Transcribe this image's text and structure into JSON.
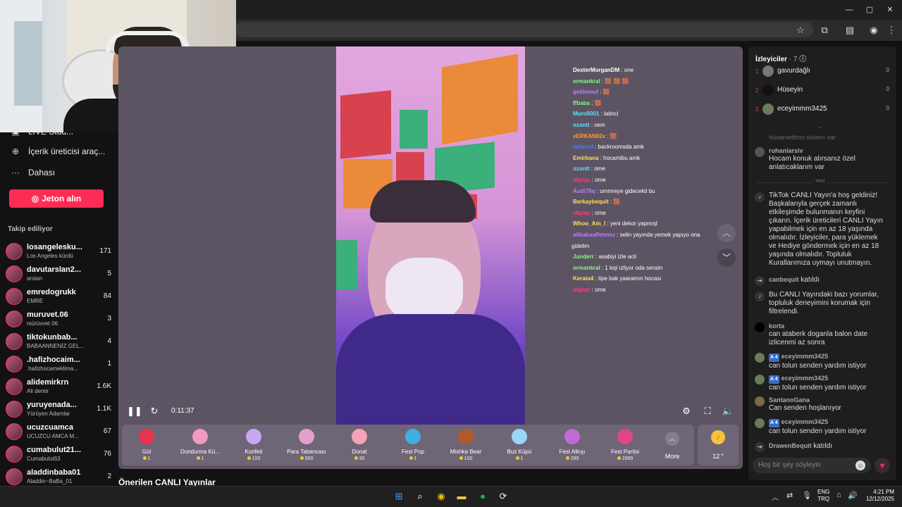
{
  "sidebar": {
    "live_center": "LIVE Stüd...",
    "creator_tools": "İçerik üreticisi araç...",
    "more": "Dahası",
    "get_coins": "Jeton alın",
    "following_header": "Takip ediliyor",
    "following": [
      {
        "name": "losangelesku...",
        "sub": "Los Angeles kürdü",
        "count": "171"
      },
      {
        "name": "davutarslan2...",
        "sub": "arslan",
        "count": "5"
      },
      {
        "name": "emredogrukk",
        "sub": "EMRE",
        "count": "84"
      },
      {
        "name": "muruvet.06",
        "sub": "mürüvvet 06",
        "count": "3"
      },
      {
        "name": "tiktokunbab...",
        "sub": "BABAANNENİZ GEL...",
        "count": "4"
      },
      {
        "name": ".hafizhocaim...",
        "sub": ".hafizhocameklima...",
        "count": "1"
      },
      {
        "name": "alidemirkrn",
        "sub": "Ali demir",
        "count": "1.6K"
      },
      {
        "name": "yuruyenada...",
        "sub": "Yürüyen Adamlar",
        "count": "1.1K"
      },
      {
        "name": "ucuzcuamca",
        "sub": "UCUZCU AMCA M...",
        "count": "67"
      },
      {
        "name": "cumabulut21...",
        "sub": "Cumabulut63",
        "count": "76"
      },
      {
        "name": "aladdinbaba01",
        "sub": "Aladdin~BaBa_01",
        "count": "2"
      }
    ]
  },
  "suggested_title": "Önerilen CANLI Yayınlar",
  "player": {
    "time": "0:11:37",
    "chat": [
      {
        "user": "DexterMorganDM",
        "text": " : one",
        "color": "#ffffff"
      },
      {
        "user": "ormankral",
        "text": " : 🟫 🟫 🟫",
        "color": "#7fff7f"
      },
      {
        "user": "geblomuf",
        "text": " : 🟫",
        "color": "#b77fff"
      },
      {
        "user": "ffbaba",
        "text": " : 🟫",
        "color": "#7fff7f"
      },
      {
        "user": "Muro8001",
        "text": " : latinci",
        "color": "#5fdfff"
      },
      {
        "user": "ozantt",
        "text": " : oem",
        "color": "#5fdfff"
      },
      {
        "user": "xERKAN02x",
        "text": " : 🟫",
        "color": "#ff9f3f"
      },
      {
        "user": "fafamuf",
        "text": " : backroomsda amk",
        "color": "#3f7fff"
      },
      {
        "user": "Emirbana",
        "text": " : hocamibu amk",
        "color": "#ffdf5f"
      },
      {
        "user": "ozantt",
        "text": " : ome",
        "color": "#5fdfff"
      },
      {
        "user": "slqzqz",
        "text": " : ome",
        "color": "#ff3f7f"
      },
      {
        "user": "Audi78q",
        "text": " : ummreye gidecekti bu",
        "color": "#b77fff"
      },
      {
        "user": "Berkaybequit",
        "text": " : 🟫",
        "color": "#ffdf5f"
      },
      {
        "user": "slqzqz",
        "text": " : ome",
        "color": "#ff3f7f"
      },
      {
        "user": "Whoo_Am_I",
        "text": " : yeni dekor yapmışl",
        "color": "#ffdf5f"
      },
      {
        "user": "alibabaaffetmez",
        "text": " : selin yayında yemek yapıyo ona",
        "color": "#b77fff"
      },
      {
        "user": "",
        "text": "gidelim",
        "color": "#ffffff"
      },
      {
        "user": "Junderr",
        "text": " : asabiyi izle acil",
        "color": "#7fff7f"
      },
      {
        "user": "ormankral",
        "text": " : 1 kişi izliyor oda sensin",
        "color": "#7fff7f"
      },
      {
        "user": "Kerata4",
        "text": " : tipe bak yaaramın hocası",
        "color": "#ffdf5f"
      },
      {
        "user": "slqzqz",
        "text": " : ome",
        "color": "#ff3f7f"
      }
    ]
  },
  "gifts": [
    {
      "name": "Gül",
      "price": "1",
      "color": "#e8334f"
    },
    {
      "name": "Dondurma Kü...",
      "price": "1",
      "color": "#f29ac0"
    },
    {
      "name": "Konfeti",
      "price": "100",
      "color": "#c9a8f2"
    },
    {
      "name": "Para Tabancası",
      "price": "500",
      "color": "#e6a0d0"
    },
    {
      "name": "Donat",
      "price": "30",
      "color": "#f5a3b8"
    },
    {
      "name": "Fest Pop",
      "price": "1",
      "color": "#3fb0e0"
    },
    {
      "name": "Mishka Bear",
      "price": "100",
      "color": "#b05a2a"
    },
    {
      "name": "Buz Küpü",
      "price": "1",
      "color": "#9ad6f5"
    },
    {
      "name": "Fest Alkışı",
      "price": "299",
      "color": "#c06ad8"
    },
    {
      "name": "Fest Partisi",
      "price": "2999",
      "color": "#e0458a"
    }
  ],
  "gift_more": "More",
  "coin_count": "12",
  "right": {
    "viewers_title": "İzleyiciler",
    "viewers_count": "· 7",
    "viewers": [
      {
        "rank": "1",
        "name": "gavurdağlı",
        "score": "0"
      },
      {
        "rank": "2",
        "name": "Hüseyin",
        "score": "0"
      },
      {
        "rank": "3",
        "name": "eceyimmm3425",
        "score": "0"
      }
    ],
    "faded_msg": "hüsamettinin selamı var",
    "comments": [
      {
        "user": "ruhaniarsiv",
        "text": "Hocam konuk alırsanız özel anlatıcaklarım var"
      }
    ],
    "new_label": "Yeni",
    "welcome": "TikTok CANLI Yayın'a hoş geldiniz! Başkalarıyla gerçek zamanlı etkileşimde bulunmanın keyfini çıkarın. İçerik üreticileri CANLI Yayın yapabilmek için en az 18 yaşında olmalıdır. İzleyiciler, para yüklemek ve Hediye göndermek için en az 18 yaşında olmalıdır. Topluluk Kurallarımıza uymayı unutmayın.",
    "joined1_user": "canbequit",
    "joined_text": "katıldı",
    "filter_notice": "Bu CANLI Yayındaki bazı yorumlar, topluluk deneyimini korumak için filtrelendi.",
    "korta_user": "korta",
    "korta_text": "can ataberk doganla balon date izlicenmi az sonra",
    "ece1_user": "eceyimmm3425",
    "ece1_text": "can tolun senden yardım istiyor",
    "ece2_user": "eceyimmm3425",
    "ece2_text": "can tolun senden yardım istiyor",
    "santano_user": "SantanoGana",
    "santano_text": "Can senden hoşlanıyor",
    "ece3_user": "eceyimmm3425",
    "ece3_text": "can tolun senden yardım istiyor",
    "badge": "A 4",
    "joined2_user": "DrawenBequit",
    "input_placeholder": "Hoş bir şey söyleyin"
  },
  "taskbar": {
    "lang": "ENG",
    "region": "TRQ",
    "time": "4:21 PM",
    "date": "12/12/2025"
  }
}
